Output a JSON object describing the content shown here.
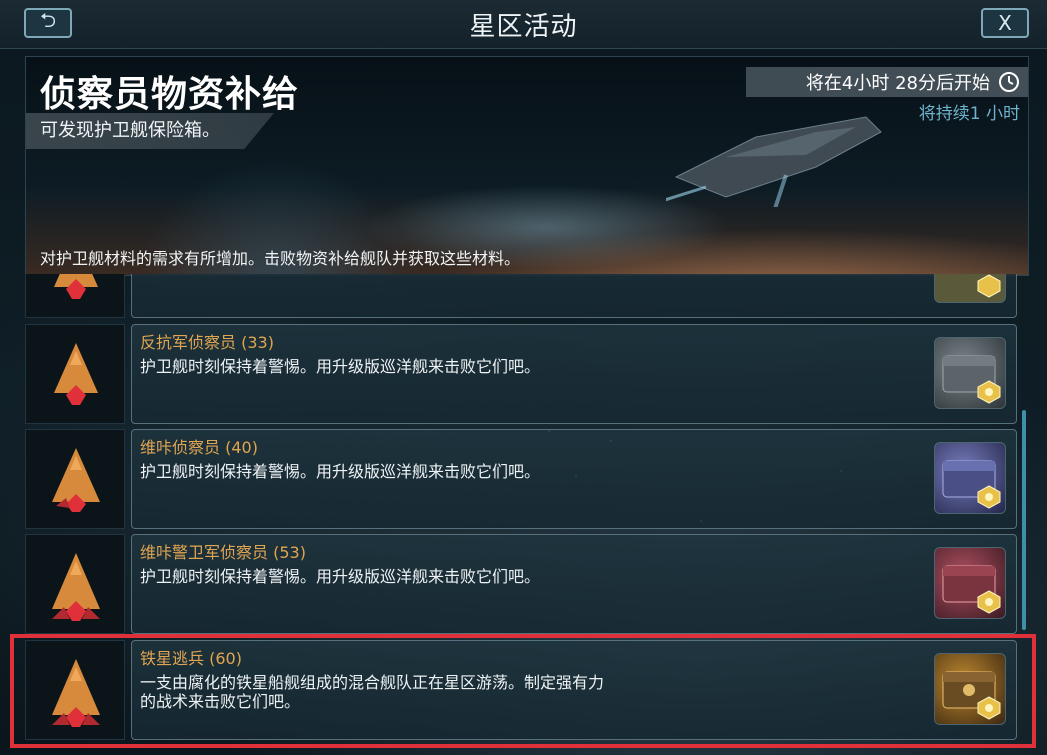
{
  "header": {
    "title": "星区活动",
    "back_label": "⮌",
    "close_label": "X"
  },
  "banner": {
    "title": "侦察员物资补给",
    "subtitle": "可发现护卫舰保险箱。",
    "description": "对护卫舰材料的需求有所增加。击败物资补给舰队并获取这些材料。",
    "timer": "将在4小时 28分后开始",
    "duration": "将持续1 小时"
  },
  "events": [
    {
      "name": "反抗军侦察员 (33)",
      "description": "护卫舰时刻保持着警惕。用升级版巡洋舰来击败它们吧。",
      "chest_color": "#6b7478"
    },
    {
      "name": "维咔侦察员 (40)",
      "description": "护卫舰时刻保持着警惕。用升级版巡洋舰来击败它们吧。",
      "chest_color": "#5a5f9a"
    },
    {
      "name": "维咔警卫军侦察员 (53)",
      "description": "护卫舰时刻保持着警惕。用升级版巡洋舰来击败它们吧。",
      "chest_color": "#8a3a48"
    },
    {
      "name": "铁星逃兵 (60)",
      "description": "一支由腐化的铁星船舰组成的混合舰队正在星区游荡。制定强有力的战术来击败它们吧。",
      "chest_color": "#8a6428"
    }
  ],
  "colors": {
    "accent": "#e1a550",
    "highlight": "#e0303a"
  }
}
